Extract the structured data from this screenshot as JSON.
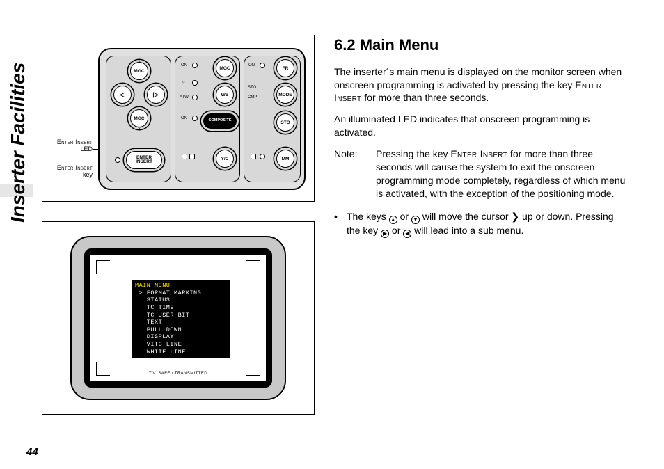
{
  "side_title": "Inserter Facilities",
  "page_number": "44",
  "heading": "6.2  Main Menu",
  "para1_a": "The inserter´s main menu is displayed on the monitor screen when onscreen programming is activated by pressing the key ",
  "para1_key": "Enter Insert",
  "para1_b": " for more than three seconds.",
  "para2": "An illuminated LED indicates that onscreen programming is activated.",
  "note_label": "Note:",
  "note_a": "Pressing the key ",
  "note_key": "Enter Insert",
  "note_b": " for more than three seconds will cause the system to exit the onscreen programming mode completely, regardless of which menu is activated, with the exception of the positioning mode.",
  "bullet_a": "The keys ",
  "bullet_b": " or ",
  "bullet_c": " will move the cursor ",
  "bullet_d": " up or down. Pressing the key ",
  "bullet_e": " or ",
  "bullet_f": " will lead into a sub menu.",
  "cursor_glyph": "❯",
  "key_up": "▲",
  "key_down": "▼",
  "key_right": "▶",
  "key_left": "◀",
  "callouts": {
    "led_a": "Enter Insert",
    "led_b": "LED",
    "key_a": "Enter Insert",
    "key_b": "key"
  },
  "panel": {
    "g1": {
      "mgc_up": "MGC",
      "left": "◁",
      "right": "▷",
      "mgc_down": "MGC",
      "enter_insert": "ENTER\nINSERT"
    },
    "g2": {
      "on1": "ON",
      "atw": "ATW",
      "on2": "ON",
      "mgc": "MGC",
      "wb": "WB",
      "composite": "COMPOSITE",
      "yc": "Y/C"
    },
    "g3": {
      "on": "ON",
      "sto_lbl": "STO",
      "cmp": "CMP",
      "fr": "FR",
      "mode": "MODE",
      "sto": "STO",
      "mm": "MM"
    }
  },
  "monitor": {
    "safe_label": "T.V. SAFE / TRANSMITTED",
    "osd_title": "MAIN MENU",
    "osd_items": [
      "FORMAT MARKING",
      "STATUS",
      "TC TIME",
      "TC USER BIT",
      "TEXT",
      "PULL DOWN",
      "DISPLAY",
      "VITC LINE",
      "WHITE LINE"
    ],
    "osd_cursor_index": 0
  }
}
